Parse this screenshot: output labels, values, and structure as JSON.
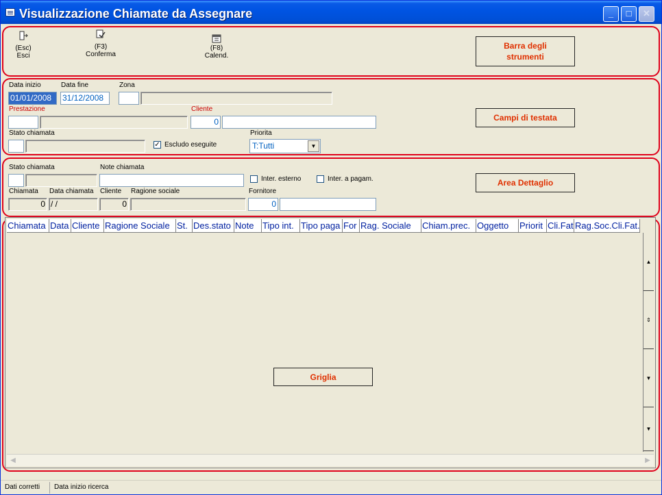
{
  "window": {
    "title": "Visualizzazione Chiamate da Assegnare",
    "controls": {
      "minimize": "_",
      "maximize": "□",
      "close": "✕"
    }
  },
  "toolbar": {
    "exit": {
      "key": "(Esc)",
      "label": "Esci",
      "icon": "exit-door-icon"
    },
    "confirm": {
      "key": "(F3)",
      "label": "Conferma",
      "icon": "confirm-check-icon"
    },
    "calendar": {
      "key": "(F8)",
      "label": "Calend.",
      "icon": "calendar-icon"
    },
    "callout": "Barra degli strumenti"
  },
  "header": {
    "start_date_label": "Data inizio",
    "start_date_value": "01/01/2008",
    "end_date_label": "Data fine",
    "end_date_value": "31/12/2008",
    "zone_label": "Zona",
    "service_label": "Prestazione",
    "client_label": "Cliente",
    "client_code": "0",
    "call_status_label": "Stato chiamata",
    "exclude_done_label": "Escludo eseguite",
    "exclude_done_checked": true,
    "priority_label": "Priorita",
    "priority_value": "T:Tutti",
    "callout": "Campi di testata"
  },
  "detail": {
    "call_status_label": "Stato chiamata",
    "call_notes_label": "Note chiamata",
    "external_label": "Inter. esterno",
    "paid_label": "Inter. a pagam.",
    "call_label": "Chiamata",
    "call_value": "0",
    "call_date_label": "Data chiamata",
    "call_date_value": "/ /",
    "client_label": "Cliente",
    "client_value": "0",
    "company_label": "Ragione sociale",
    "supplier_label": "Fornitore",
    "supplier_value": "0",
    "callout": "Area Dettaglio"
  },
  "grid": {
    "columns": [
      "Chiamata",
      "Data",
      "Cliente",
      "Ragione Sociale",
      "St.",
      "Des.stato",
      "Note",
      "Tipo int.",
      "Tipo paga",
      "For",
      "Rag. Sociale",
      "Chiam.prec.",
      "Oggetto",
      "Priorit",
      "Cli.Fat",
      "Rag.Soc.Cli.Fat."
    ],
    "callout": "Griglia"
  },
  "status": {
    "left": "Dati corretti",
    "right": "Data inizio ricerca"
  },
  "colors": {
    "section_border": "#e0001a",
    "callout_text": "#e03000",
    "titlebar": "#0054e3"
  }
}
